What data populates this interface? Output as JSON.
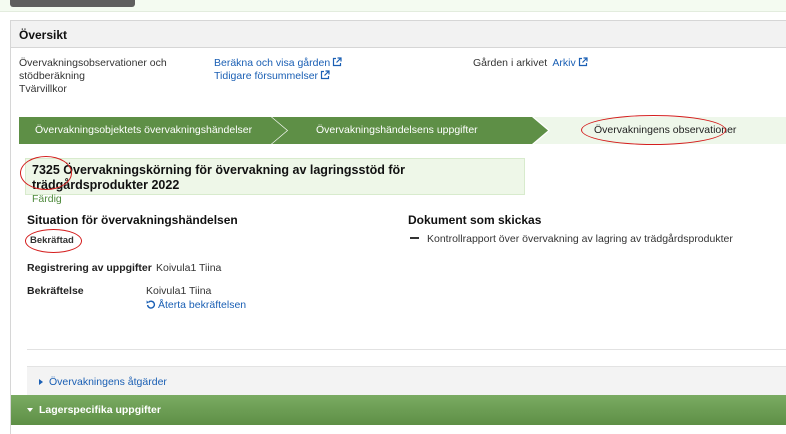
{
  "overview": {
    "title": "Översikt",
    "col1": [
      "Övervakningsobservationer och",
      "stödberäkning",
      "Tvärvillkor"
    ],
    "links": [
      {
        "label": "Beräkna och visa gården",
        "icon": "external-link-icon"
      },
      {
        "label": "Tidigare försummelser",
        "icon": "external-link-icon"
      }
    ],
    "archive_label": "Gården i arkivet",
    "archive_link": "Arkiv"
  },
  "steps": [
    {
      "label": "Övervakningsobjektets övervakningshändelser",
      "state": "done"
    },
    {
      "label": "Övervakningshändelsens uppgifter",
      "state": "done"
    },
    {
      "label": "Övervakningens observationer",
      "state": "current"
    }
  ],
  "case": {
    "title": "7325 Övervakningskörning för övervakning av lagringsstöd för trädgårdsprodukter 2022",
    "status": "Färdig"
  },
  "situation": {
    "title": "Situation för övervakningshändelsen",
    "badge": "Bekräftad",
    "registration_label": "Registrering av uppgifter",
    "registration_value": "Koivula1 Tiina",
    "confirmation_label": "Bekräftelse",
    "confirmation_value": "Koivula1 Tiina",
    "undo_label": "Återta bekräftelsen"
  },
  "documents": {
    "title": "Dokument som skickas",
    "items": [
      "Kontrollrapport över övervakning av lagring av trädgårdsprodukter"
    ]
  },
  "sections": {
    "actions": "Övervakningens åtgärder",
    "storage": "Lagerspecifika uppgifter"
  },
  "colors": {
    "accent_green": "#5e8f46",
    "link_blue": "#1a5fb4",
    "annotation_red": "#d41e1e"
  }
}
